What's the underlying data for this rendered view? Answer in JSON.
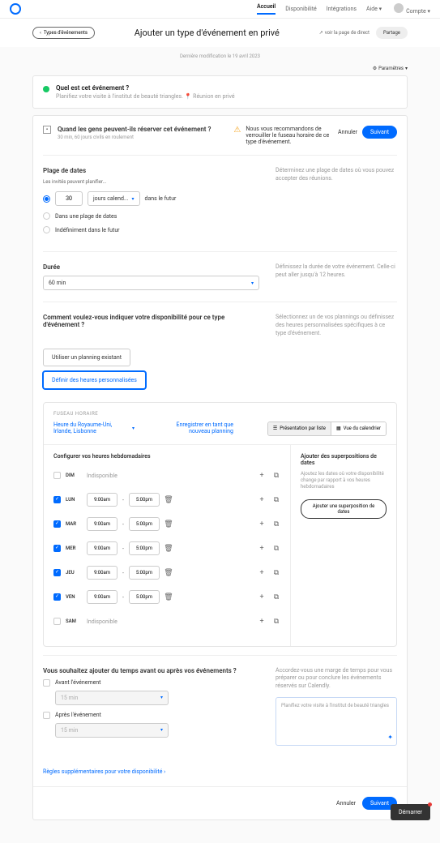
{
  "nav": {
    "home": "Accueil",
    "avail": "Disponibilité",
    "integ": "Intégrations",
    "help": "Aide",
    "account": "Compte"
  },
  "back": "Types d'événements",
  "title": "Ajouter un type d'événement en privé",
  "viewPage": "voir la page de direct",
  "share": "Partage",
  "lastMod": "Dernière modification le 19 avril 2023",
  "settings": "Paramètres",
  "eventCard": {
    "q": "Quel est cet événement ?",
    "sub": "Planifiez votre visite à l'institut de beauté triangles.",
    "badge": "Réunion en privé"
  },
  "panel": {
    "q": "Quand les gens peuvent-ils réserver cet événement ?",
    "sub": "30 min, 60 jours civils en roulement",
    "warn": "Nous vous recommandons de verrouiller le fuseau horaire de ce type d'événement.",
    "cancel": "Annuler",
    "next": "Suivant"
  },
  "range": {
    "h": "Plage de dates",
    "hint": "Les invités peuvent planifier...",
    "days": "30",
    "unit": "jours calend...",
    "future": "dans le futur",
    "opt2": "Dans une plage de dates",
    "opt3": "Indéfiniment dans le futur",
    "desc": "Déterminez une plage de dates où vous pouvez accepter des réunions."
  },
  "dur": {
    "h": "Durée",
    "val": "60 min",
    "desc": "Définissez la durée de votre événement. Celle-ci peut aller jusqu'à 12 heures."
  },
  "avail": {
    "h": "Comment voulez-vous indiquer votre disponibilité pour ce type d'événement ?",
    "opt1": "Utiliser un planning existant",
    "opt2": "Définir des heures personnalisées",
    "desc": "Sélectionnez un de vos plannings ou définissez des heures personnalisées spécifiques à ce type d'événement."
  },
  "tz": {
    "label": "FUSEAU HORAIRE",
    "val": "Heure du Royaume-Uni, Irlande, Lisbonne",
    "save": "Enregistrer en tant que nouveau planning",
    "list": "Présentation par liste",
    "cal": "Vue du calendrier"
  },
  "weekly": {
    "h": "Configurer vos heures hebdomadaires",
    "unavail": "Indisponible",
    "start": "9:00am",
    "end": "5:00pm",
    "days": [
      "DIM",
      "LUN",
      "MAR",
      "MER",
      "JEU",
      "VEN",
      "SAM"
    ]
  },
  "overlay": {
    "h": "Ajouter des superpositions de dates",
    "p": "Ajoutez les dates où votre disponibilité change par rapport à vos heures hebdomadaires",
    "btn": "Ajouter une superposition de dates"
  },
  "buffer": {
    "q": "Vous souhaitez ajouter du temps avant ou après vos événements ?",
    "before": "Avant l'événement",
    "after": "Après l'événement",
    "val": "15 min",
    "desc": "Accordez-vous une marge de temps pour vous préparer ou pour conclure les événements réservés sur Calendly.",
    "note": "Planifiez votre visite à l'institut de beauté triangles"
  },
  "rules": "Règles supplémentaires pour votre disponibilité",
  "chat": "Démarrer"
}
